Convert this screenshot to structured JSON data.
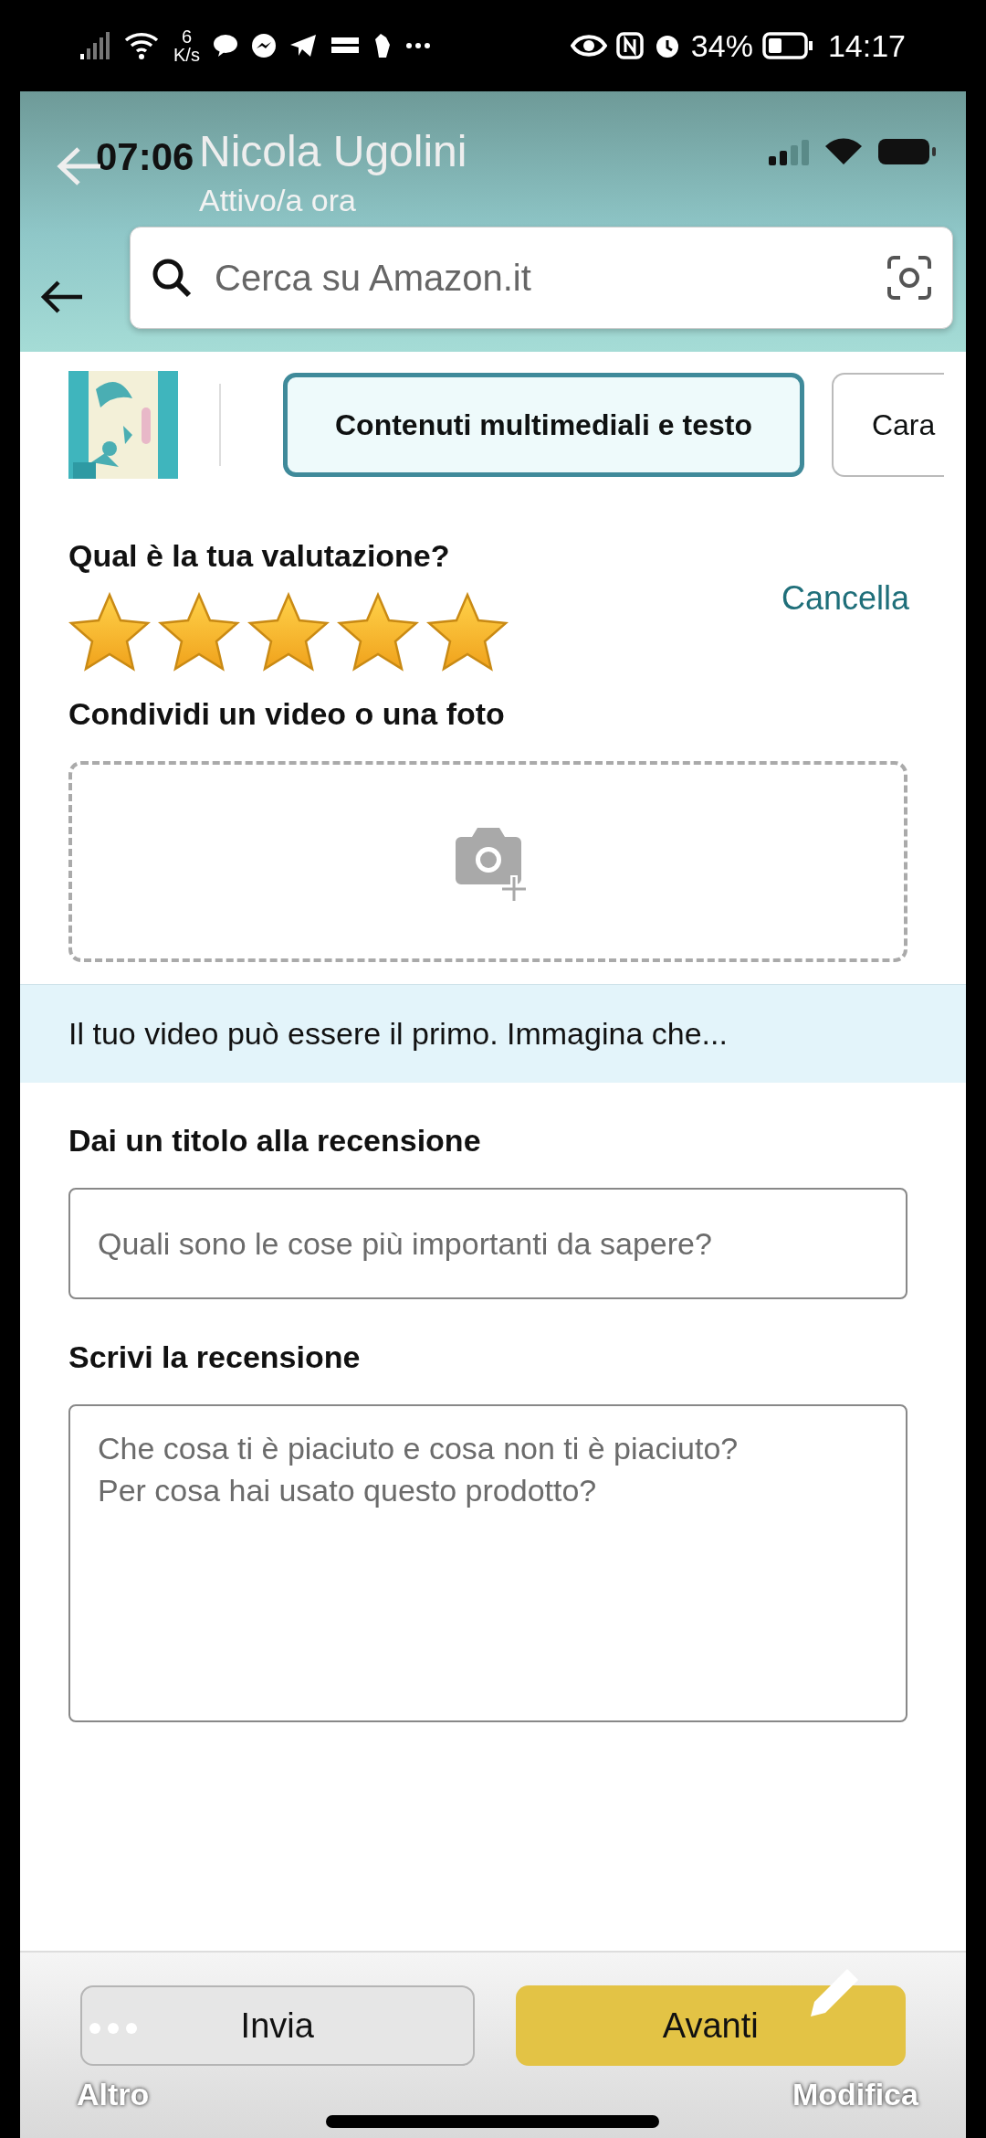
{
  "status_bar": {
    "network_speed": [
      "6",
      "K/s"
    ],
    "battery": "34%",
    "time": "14:17"
  },
  "chat_overlay": {
    "contact": "Nicola Ugolini",
    "presence": "Attivo/a ora",
    "more_label": "Altro",
    "edit_label": "Modifica"
  },
  "inner_status_bar": {
    "time": "07:06"
  },
  "search": {
    "placeholder": "Cerca su Amazon.it"
  },
  "tabs": [
    {
      "label": "Contenuti multimediali e testo",
      "selected": true
    },
    {
      "label": "Cara",
      "selected": false
    }
  ],
  "rating": {
    "question": "Qual è la tua valutazione?",
    "clear": "Cancella",
    "stars": 5
  },
  "media": {
    "title": "Condividi un video o una foto"
  },
  "banner": "Il tuo video può essere il primo. Immagina che...",
  "review_title": {
    "label": "Dai un titolo alla recensione",
    "placeholder": "Quali sono le cose più importanti da sapere?"
  },
  "review_text": {
    "label": "Scrivi la recensione",
    "placeholder": "Che cosa ti è piaciuto e cosa non ti è piaciuto?\nPer cosa hai usato questo prodotto?"
  },
  "buttons": [
    {
      "label": "Invia",
      "kind": "secondary"
    },
    {
      "label": "Avanti",
      "kind": "primary"
    }
  ]
}
